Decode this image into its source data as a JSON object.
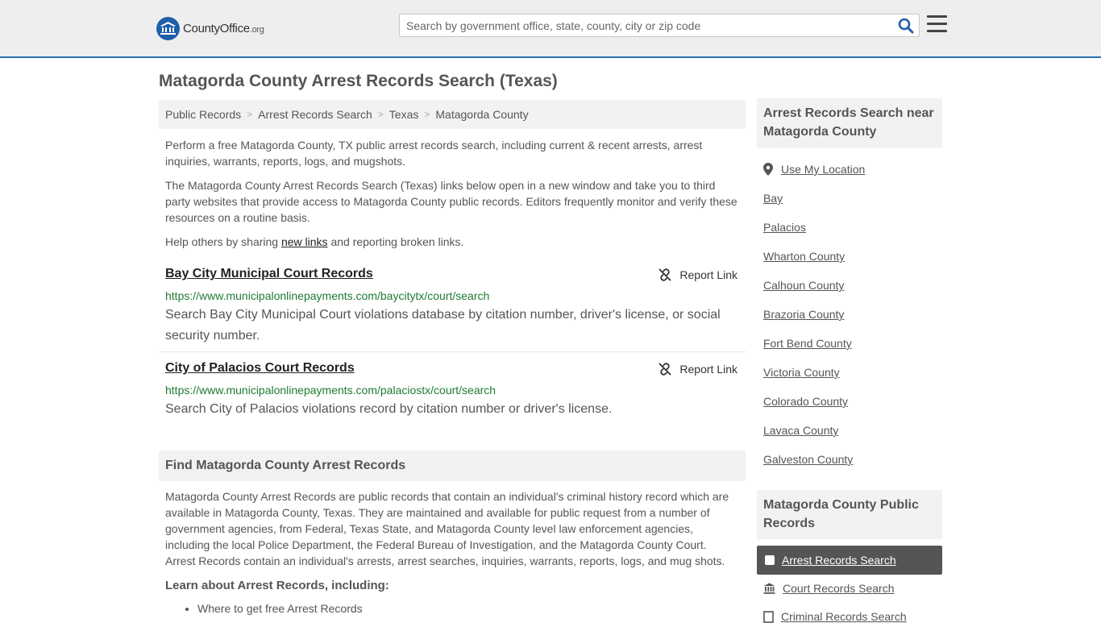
{
  "header": {
    "logo_main": "CountyOffice",
    "logo_suffix": ".org",
    "search_placeholder": "Search by government office, state, county, city or zip code"
  },
  "page_title": "Matagorda County Arrest Records Search (Texas)",
  "breadcrumb": [
    "Public Records",
    "Arrest Records Search",
    "Texas",
    "Matagorda County"
  ],
  "intro": {
    "p1": "Perform a free Matagorda County, TX public arrest records search, including current & recent arrests, arrest inquiries, warrants, reports, logs, and mugshots.",
    "p2": "The Matagorda County Arrest Records Search (Texas) links below open in a new window and take you to third party websites that provide access to Matagorda County public records. Editors frequently monitor and verify these resources on a routine basis.",
    "p3_before": "Help others by sharing ",
    "p3_link": "new links",
    "p3_after": " and reporting broken links."
  },
  "records": [
    {
      "title": "Bay City Municipal Court Records",
      "report_label": "Report Link",
      "url": "https://www.municipalonlinepayments.com/baycitytx/court/search",
      "desc": "Search Bay City Municipal Court violations database by citation number, driver's license, or social security number."
    },
    {
      "title": "City of Palacios Court Records",
      "report_label": "Report Link",
      "url": "https://www.municipalonlinepayments.com/palaciostx/court/search",
      "desc": "Search City of Palacios violations record by citation number or driver's license."
    }
  ],
  "find_section": {
    "heading": "Find Matagorda County Arrest Records",
    "text": "Matagorda County Arrest Records are public records that contain an individual's criminal history record which are available in Matagorda County, Texas. They are maintained and available for public request from a number of government agencies, from Federal, Texas State, and Matagorda County level law enforcement agencies, including the local Police Department, the Federal Bureau of Investigation, and the Matagorda County Court. Arrest Records contain an individual's arrests, arrest searches, inquiries, warrants, reports, logs, and mug shots.",
    "learn_heading": "Learn about Arrest Records, including:",
    "learn_items": [
      "Where to get free Arrest Records"
    ]
  },
  "sidebar": {
    "near_heading": "Arrest Records Search near Matagorda County",
    "use_location": "Use My Location",
    "near_links": [
      "Bay",
      "Palacios",
      "Wharton County",
      "Calhoun County",
      "Brazoria County",
      "Fort Bend County",
      "Victoria County",
      "Colorado County",
      "Lavaca County",
      "Galveston County"
    ],
    "public_heading": "Matagorda County Public Records",
    "public_items": [
      {
        "label": "Arrest Records Search",
        "icon": "checkbox-icon",
        "active": true
      },
      {
        "label": "Court Records Search",
        "icon": "courthouse-icon",
        "active": false
      },
      {
        "label": "Criminal Records Search",
        "icon": "document-icon",
        "active": false
      }
    ]
  },
  "colors": {
    "accent": "#2b70b4",
    "url_green": "#1e7b32",
    "active_bg": "#555555"
  }
}
